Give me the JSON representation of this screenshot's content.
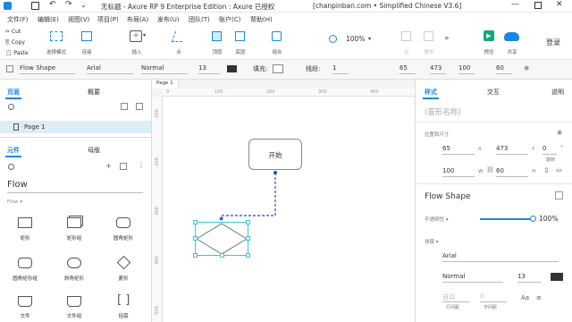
{
  "titlebar": {
    "title": "无标题 - Axure RP 9 Enterprise Edition : Axure 已授权",
    "site": "[chanpinban.com • Simplified Chinese V3.6]"
  },
  "menu": [
    "文件(F)",
    "编辑(E)",
    "视图(V)",
    "项目(P)",
    "布局(A)",
    "发布(U)",
    "团队(T)",
    "账户(C)",
    "帮助(H)"
  ],
  "toolbar": {
    "cut": "Cut",
    "copy": "Copy",
    "paste": "Paste",
    "select_mode": "选择模式",
    "connect": "连接",
    "insert": "插入",
    "point": "点",
    "top": "顶层",
    "bottom": "底层",
    "combine": "组合",
    "zoom": "100%",
    "left": "左",
    "center": "居中",
    "preview": "预览",
    "share": "共享",
    "login": "登录"
  },
  "stylebar": {
    "style": "Flow Shape",
    "font": "Arial",
    "weight": "Normal",
    "size": "13",
    "fill": "填充:",
    "line": "线段:",
    "line_width": "1",
    "x": "65",
    "y": "473",
    "w": "100",
    "h": "60"
  },
  "left": {
    "tab_pages": "页面",
    "tab_outline": "概要",
    "page1": "Page 1",
    "tab_widgets": "元件",
    "tab_masters": "母版",
    "library": "Flow",
    "section": "Flow ▾",
    "widgets": [
      "矩形",
      "矩形组",
      "圆角矩形",
      "圆角矩形组",
      "斜角矩形",
      "菱形",
      "文件",
      "文件组",
      "括弧"
    ]
  },
  "canvas": {
    "tab": "Page 1",
    "ruler_h": [
      "0",
      "100",
      "200",
      "300",
      "400"
    ],
    "ruler_v": [
      "100",
      "200",
      "300",
      "400",
      "500"
    ],
    "start_label": "开始"
  },
  "right": {
    "tab_style": "样式",
    "tab_interact": "交互",
    "tab_notes": "说明",
    "shape_name": "(菱形名称)",
    "pos_size": "位置和尺寸",
    "x": "65",
    "x_lbl": "X",
    "y": "473",
    "y_lbl": "Y",
    "rot": "0",
    "rot_unit": "°",
    "rot_lbl": "旋转",
    "w": "100",
    "w_lbl": "W",
    "h": "60",
    "h_lbl": "H",
    "style_name": "Flow Shape",
    "opacity_lbl": "不透明性 ▾",
    "opacity": "100%",
    "font_lbl": "排版 ▾",
    "font": "Arial",
    "weight": "Normal",
    "size": "13",
    "auto": "自动",
    "zero": "0",
    "line_spacing": "行间距",
    "char_spacing": "字间距"
  }
}
